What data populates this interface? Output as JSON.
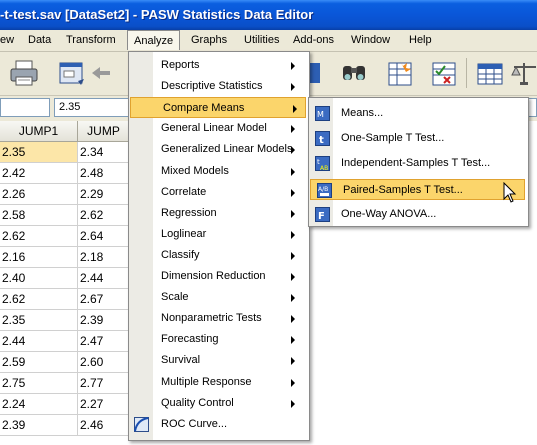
{
  "window": {
    "title": "-t-test.sav [DataSet2] - PASW Statistics Data Editor"
  },
  "menubar": {
    "items": [
      "ew",
      "Data",
      "Transform",
      "Analyze",
      "Graphs",
      "Utilities",
      "Add-ons",
      "Window",
      "Help"
    ],
    "active": "Analyze"
  },
  "toolbar": {
    "icons": [
      "print-icon",
      "dialog-recall-icon",
      "undo-icon",
      "variables-icon",
      "find-icon",
      "insert-cases-icon",
      "select-cases-icon",
      "value-labels-icon",
      "scales-icon"
    ]
  },
  "cell_editor": {
    "value": "2.35"
  },
  "grid": {
    "columns": [
      "JUMP1",
      "JUMP"
    ],
    "rows": [
      [
        "2.35",
        "2.34"
      ],
      [
        "2.42",
        "2.48"
      ],
      [
        "2.26",
        "2.29"
      ],
      [
        "2.58",
        "2.62"
      ],
      [
        "2.62",
        "2.64"
      ],
      [
        "2.16",
        "2.18"
      ],
      [
        "2.40",
        "2.44"
      ],
      [
        "2.62",
        "2.67"
      ],
      [
        "2.35",
        "2.39"
      ],
      [
        "2.44",
        "2.47"
      ],
      [
        "2.59",
        "2.60"
      ],
      [
        "2.75",
        "2.77"
      ],
      [
        "2.24",
        "2.27"
      ],
      [
        "2.39",
        "2.46"
      ]
    ]
  },
  "analyze_menu": {
    "items": [
      {
        "label": "Reports",
        "submenu": true
      },
      {
        "label": "Descriptive Statistics",
        "submenu": true
      },
      {
        "label": "Compare Means",
        "submenu": true,
        "highlighted": true
      },
      {
        "label": "General Linear Model",
        "submenu": true
      },
      {
        "label": "Generalized Linear Models",
        "submenu": true
      },
      {
        "label": "Mixed Models",
        "submenu": true
      },
      {
        "label": "Correlate",
        "submenu": true
      },
      {
        "label": "Regression",
        "submenu": true
      },
      {
        "label": "Loglinear",
        "submenu": true
      },
      {
        "label": "Classify",
        "submenu": true
      },
      {
        "label": "Dimension Reduction",
        "submenu": true
      },
      {
        "label": "Scale",
        "submenu": true
      },
      {
        "label": "Nonparametric Tests",
        "submenu": true
      },
      {
        "label": "Forecasting",
        "submenu": true
      },
      {
        "label": "Survival",
        "submenu": true
      },
      {
        "label": "Multiple Response",
        "submenu": true
      },
      {
        "label": "Quality Control",
        "submenu": true
      },
      {
        "label": "ROC Curve...",
        "submenu": false
      }
    ]
  },
  "compare_means_menu": {
    "items": [
      {
        "label": "Means...",
        "icon": "means-icon"
      },
      {
        "label": "One-Sample T Test...",
        "icon": "t-test-icon"
      },
      {
        "label": "Independent-Samples T Test...",
        "icon": "independent-t-icon"
      },
      {
        "label": "Paired-Samples T Test...",
        "icon": "paired-t-icon",
        "highlighted": true
      },
      {
        "label": "One-Way ANOVA...",
        "icon": "anova-icon"
      }
    ]
  }
}
